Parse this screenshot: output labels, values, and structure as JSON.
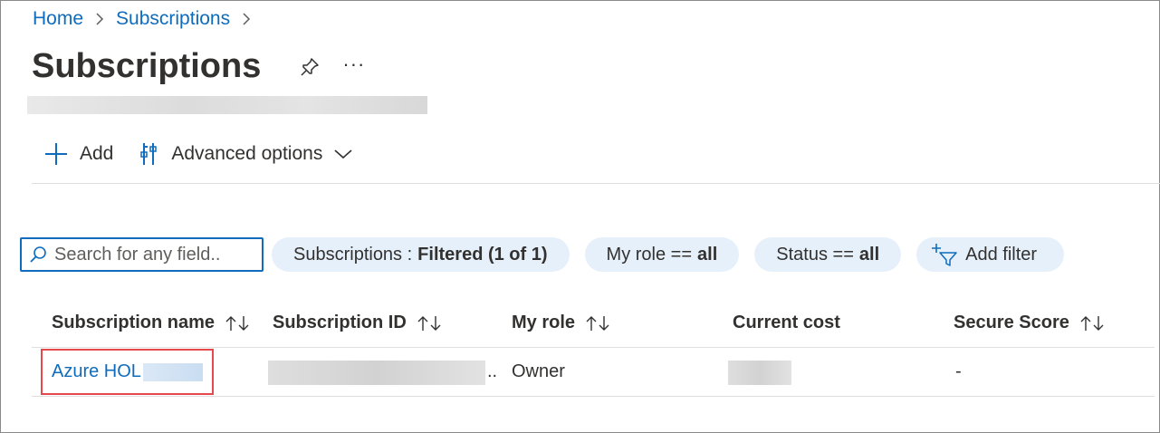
{
  "breadcrumb": {
    "home": "Home",
    "current": "Subscriptions"
  },
  "page": {
    "title": "Subscriptions",
    "more": "···"
  },
  "toolbar": {
    "add_label": "Add",
    "advanced_label": "Advanced options"
  },
  "filters": {
    "search_placeholder": "Search for any field..",
    "subscriptions_key": "Subscriptions :",
    "subscriptions_value": "Filtered (1 of 1)",
    "role_key": "My role ==",
    "role_value": "all",
    "status_key": "Status ==",
    "status_value": "all",
    "add_filter_label": "Add filter"
  },
  "table": {
    "columns": [
      "Subscription name",
      "Subscription ID",
      "My role",
      "Current cost",
      "Secure Score"
    ],
    "rows": [
      {
        "name": "Azure HOL",
        "id_suffix": "..",
        "role": "Owner",
        "secure_score": "-"
      }
    ]
  },
  "colors": {
    "accent": "#0f6cbd",
    "pill_bg": "#e6f0fa",
    "highlight": "#e5484d"
  }
}
